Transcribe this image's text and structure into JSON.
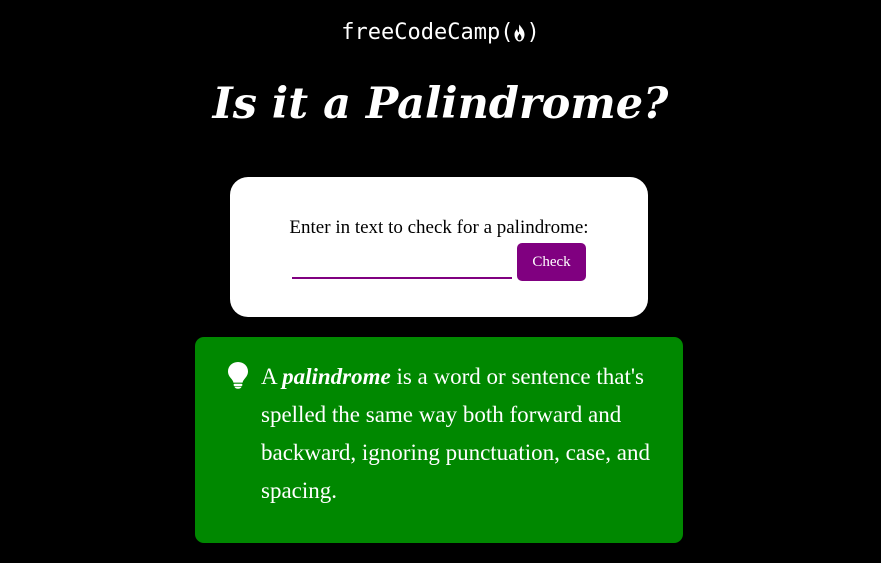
{
  "logo": {
    "text": "freeCodeCamp(",
    "close": ")",
    "icon": "flame-icon"
  },
  "page": {
    "title": "Is it a Palindrome?"
  },
  "form": {
    "label": "Enter in text to check for a palindrome:",
    "input_value": "",
    "input_placeholder": "",
    "button_label": "Check"
  },
  "info": {
    "icon": "lightbulb-icon",
    "prefix": "A ",
    "term": "palindrome",
    "rest": " is a word or sentence that's spelled the same way both forward and backward, ignoring punctuation, case, and spacing."
  },
  "colors": {
    "background": "#000000",
    "accent": "#800080",
    "info_background": "#008800",
    "card_background": "#ffffff",
    "text_light": "#ffffff"
  }
}
